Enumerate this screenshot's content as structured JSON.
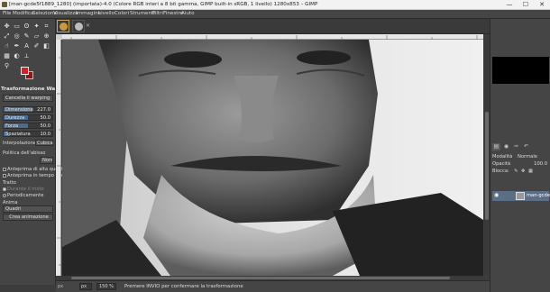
{
  "window": {
    "title": "[man-gcde5f1889_1280] (importata)-4.0 (Colore RGB interi a 8 bit gamma, GIMP built-in sRGB, 1 livello) 1280x853 – GIMP",
    "minimize": "—",
    "maximize": "☐",
    "close": "✕"
  },
  "menubar": [
    "File",
    "Modifica",
    "Seleziona",
    "Visualizza",
    "Immagine",
    "Livello",
    "Colori",
    "Strumenti",
    "Filtri",
    "Finestre",
    "Aiuto"
  ],
  "toolbox": {
    "tools": [
      "move-tool",
      "rect-select-tool",
      "lasso-tool",
      "fuzzy-select-tool",
      "crop-tool",
      "unified-transform-tool",
      "warp-transform-tool",
      "paintbrush-tool",
      "eraser-tool",
      "clone-tool",
      "smudge-tool",
      "path-tool",
      "text-tool",
      "color-picker-tool",
      "zoom-tool",
      "bucket-fill-tool",
      "gradient-tool",
      "dodge-burn-tool",
      "measure-tool"
    ],
    "fg_color": "#c8252a",
    "bg_color": "#8a1a1a"
  },
  "tool_options": {
    "title": "Trasformazione Warp",
    "cancel_label": "Cancella il warping",
    "sliders": [
      {
        "label": "Dimensione",
        "value": "227.0",
        "fraction": 0.6
      },
      {
        "label": "Durezza",
        "value": "50.0",
        "fraction": 0.5
      },
      {
        "label": "Forza",
        "value": "50.0",
        "fraction": 0.5
      },
      {
        "label": "Spaziatura",
        "value": "10.0",
        "fraction": 0.1
      }
    ],
    "interpolation_label": "Interpolazione",
    "interpolation_value": "Cubica",
    "abyss_label": "Politica dell'abisso",
    "abyss_value": "Nore",
    "high_quality_preview": "Anteprima di alta qualità",
    "realtime_preview": "Anteprima in tempo reale",
    "stroke_label": "Tratto",
    "during_motion": "Durante il moto",
    "periodically": "Periodicamente",
    "animate_label": "Anima",
    "frames_value": "Quadri",
    "create_animation": "Crea animazione"
  },
  "statusbar": {
    "coords": "px",
    "unit": "px",
    "zoom": "150 %",
    "message": "Premere INVIO per confermare la trasformazione"
  },
  "layers": {
    "mode_label": "Modalità",
    "mode_value": "Normale",
    "opacity_label": "Opacità",
    "opacity_value": "100.0",
    "lock_label": "Blocca:",
    "layer_name": "man-gcde5"
  },
  "colors": {
    "accent": "#5b6e85",
    "panel_bg": "#454545",
    "dark_bg": "#3c3c3c"
  }
}
